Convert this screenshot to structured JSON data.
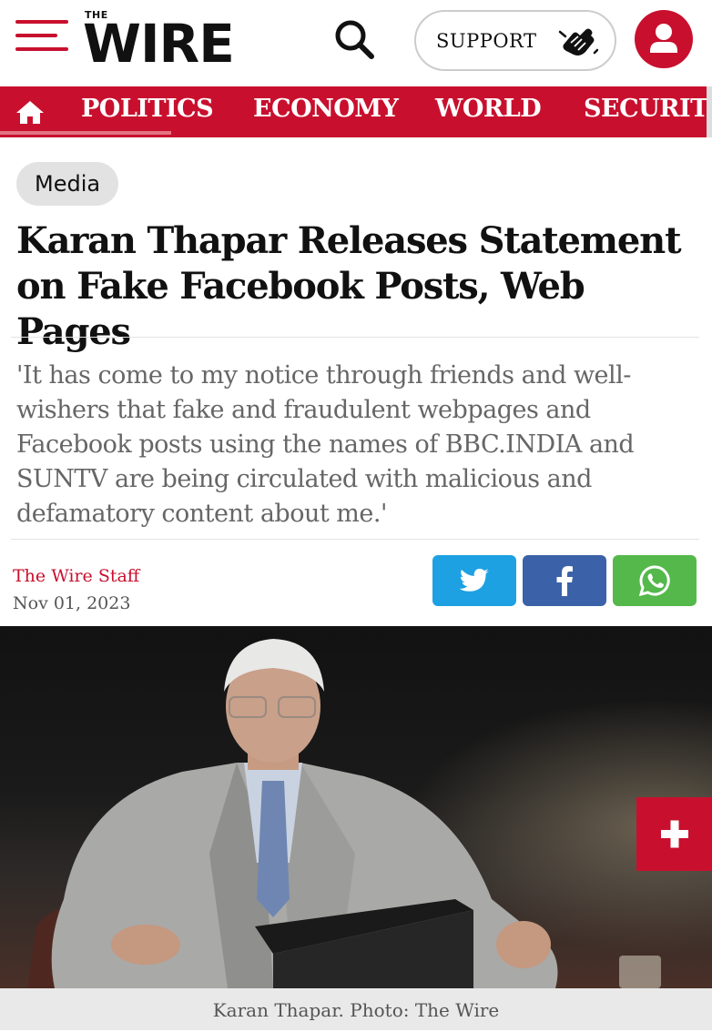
{
  "header": {
    "logo_the": "THE",
    "logo_wire": "WIRE",
    "support_label": "SUPPORT"
  },
  "nav": {
    "items": [
      "POLITICS",
      "ECONOMY",
      "WORLD",
      "SECURITY"
    ]
  },
  "article": {
    "category": "Media",
    "headline": "Karan Thapar Releases Statement on Fake Facebook Posts, Web Pages",
    "standfirst": "'It has come to my notice through friends and well-wishers that fake and fraudulent webpages and Facebook posts using the names of BBC.INDIA and SUNTV are being circulated with malicious and defamatory content about me.'",
    "author": "The Wire Staff",
    "date": "Nov 01, 2023",
    "caption": "Karan Thapar. Photo: The Wire"
  },
  "share": {
    "twitter_icon": "twitter-icon",
    "facebook_icon": "facebook-icon",
    "whatsapp_icon": "whatsapp-icon"
  },
  "colors": {
    "brand_red": "#c8102e",
    "twitter": "#1da1e2",
    "facebook": "#3b62a8",
    "whatsapp": "#55b84b"
  }
}
